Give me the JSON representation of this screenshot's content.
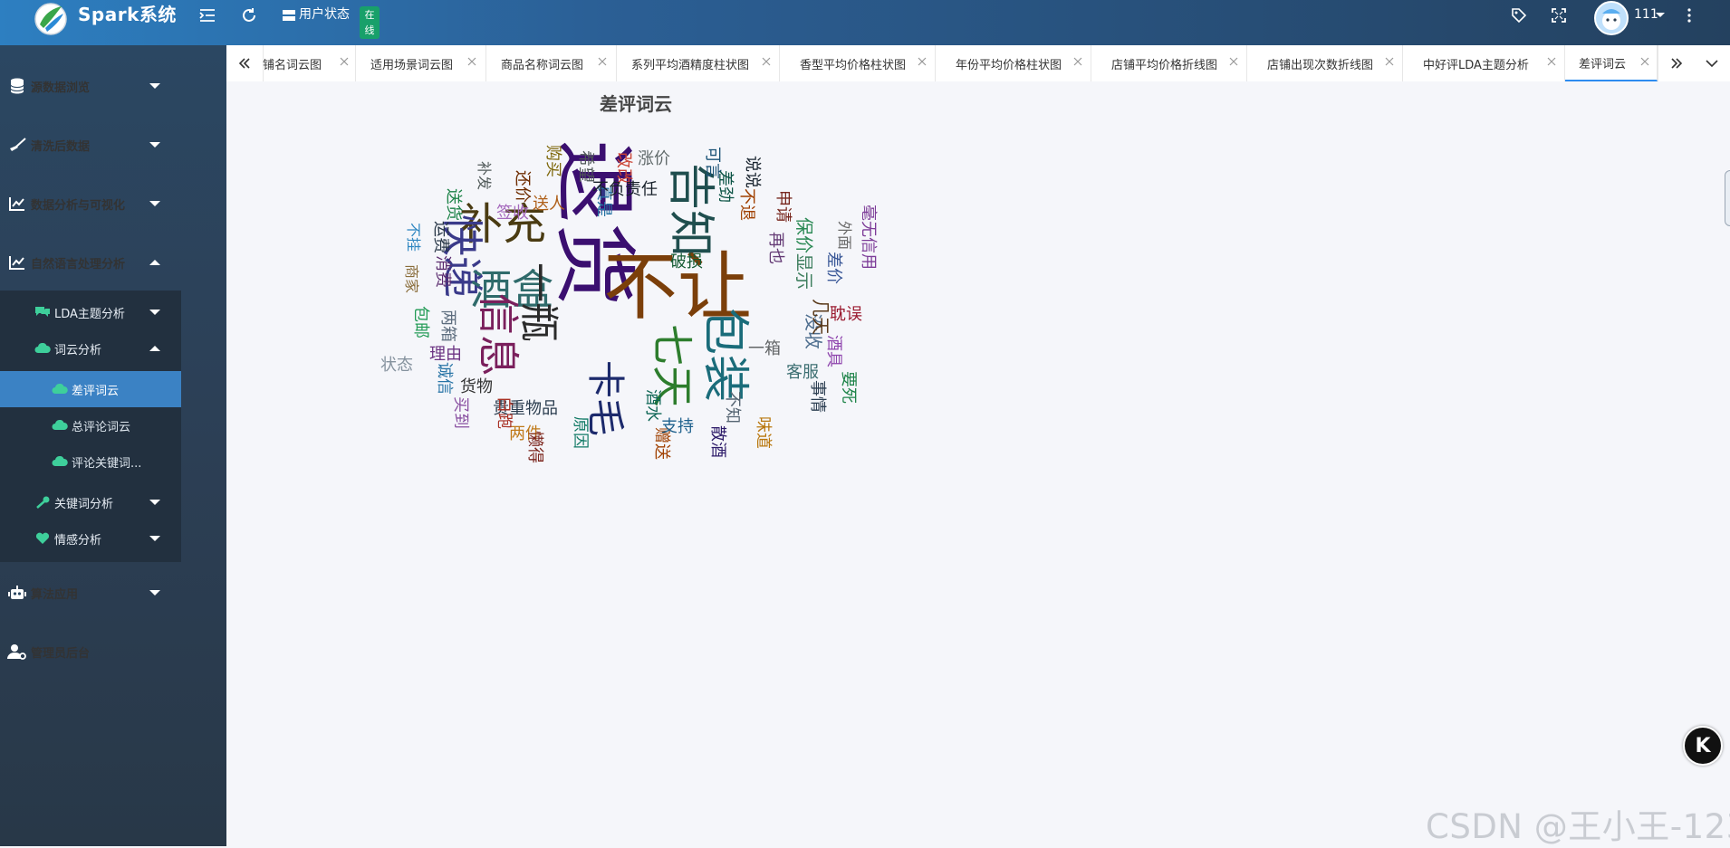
{
  "header": {
    "brand": "Spark系统",
    "user_status_label": "用户状态",
    "user_status_badge": "在\n线",
    "username": "111"
  },
  "sidebar": {
    "menu": [
      {
        "label": "源数据浏览",
        "icon": "database-icon",
        "expanded": false
      },
      {
        "label": "清洗后数据",
        "icon": "broom-icon",
        "expanded": false
      },
      {
        "label": "数据分析与可视化",
        "icon": "chart-line-icon",
        "expanded": false
      },
      {
        "label": "自然语言处理分析",
        "icon": "chart-line-icon",
        "expanded": true
      },
      {
        "label": "算法应用",
        "icon": "robot-icon",
        "expanded": false
      },
      {
        "label": "管理员后台",
        "icon": "user-cog-icon",
        "expanded": false
      }
    ],
    "nlp_submenu": [
      {
        "label": "LDA主题分析",
        "icon": "comments-icon",
        "expanded": false
      },
      {
        "label": "词云分析",
        "icon": "cloud-icon",
        "expanded": true
      },
      {
        "label": "关键词分析",
        "icon": "key-icon",
        "expanded": false
      },
      {
        "label": "情感分析",
        "icon": "heart-icon",
        "expanded": false
      }
    ],
    "wordcloud_items": [
      {
        "label": "差评词云",
        "active": true
      },
      {
        "label": "总评论词云",
        "active": false
      },
      {
        "label": "评论关键词...",
        "active": false
      }
    ]
  },
  "tabs": [
    {
      "label": "铺名词云图",
      "active": false
    },
    {
      "label": "适用场景词云图",
      "active": false
    },
    {
      "label": "商品名称词云图",
      "active": false
    },
    {
      "label": "系列平均酒精度柱状图",
      "active": false
    },
    {
      "label": "香型平均价格柱状图",
      "active": false
    },
    {
      "label": "年份平均价格柱状图",
      "active": false
    },
    {
      "label": "店铺平均价格折线图",
      "active": false
    },
    {
      "label": "店铺出现次数折线图",
      "active": false
    },
    {
      "label": "中好评LDA主题分析",
      "active": false
    },
    {
      "label": "差评词云",
      "active": true
    }
  ],
  "page": {
    "title": "差评词云"
  },
  "wordcloud": {
    "words": [
      "退货",
      "不让",
      "告知",
      "补充",
      "快递",
      "酒盒",
      "一瓶",
      "信息",
      "七天",
      "包装",
      "卡毛",
      "两件",
      "贵重物品",
      "货物",
      "客服",
      "没收",
      "显示",
      "几天",
      "保价",
      "外面",
      "毫无信用",
      "差价",
      "耽误",
      "酒具",
      "事情",
      "要死",
      "味道",
      "不知",
      "散酒",
      "赠送",
      "支持",
      "酒水",
      "原因",
      "懒得",
      "白跑",
      "买到",
      "诚信",
      "理由",
      "两箱",
      "状态",
      "包邮",
      "商家",
      "消费",
      "不挂",
      "运费",
      "签收",
      "送货",
      "补发",
      "还价",
      "送人",
      "购买",
      "希望",
      "真是",
      "改改",
      "涨价",
      "可言",
      "差劲",
      "不负责任",
      "不退",
      "申请",
      "再也",
      "破损",
      "一箱",
      "说说"
    ],
    "colors": [
      "#3b0f70",
      "#7b3f0a",
      "#1f4e4e",
      "#4a3b12",
      "#3a3a8a",
      "#2f6b6b",
      "#2b2b2b",
      "#7a1f5c",
      "#2d7d2d",
      "#1a6c7a",
      "#1c2a6c",
      "#c07a1a",
      "#2c3e50",
      "#333333",
      "#3c6e71",
      "#4f6f8f",
      "#3f7f5f",
      "#5a3a1a",
      "#2e8b57",
      "#6a6a6a",
      "#7d3c98",
      "#3b5998",
      "#9b1b30",
      "#8e44ad",
      "#2e4053",
      "#1e8449",
      "#b9770e",
      "#566573",
      "#2d1b69",
      "#a04000",
      "#1f618d",
      "#0e6655",
      "#117a65",
      "#7b241c",
      "#a93226",
      "#884ea0",
      "#2874a6",
      "#6c3483",
      "#5d6d7e",
      "#85929e",
      "#239b56",
      "#8a6d3b",
      "#5b2c6f",
      "#2e86c1",
      "#283747",
      "#a569bd",
      "#1d8348",
      "#515a5a",
      "#6e2c00",
      "#af601a",
      "#7d6608",
      "#4d5656",
      "#2471a3",
      "#cb4335",
      "#616a6b",
      "#1a5276",
      "#0b5345",
      "#17202a",
      "#a04000",
      "#78281f",
      "#633974",
      "#145a32",
      "#626567",
      "#1b2631"
    ]
  },
  "watermark": "CSDN @王小王-123"
}
